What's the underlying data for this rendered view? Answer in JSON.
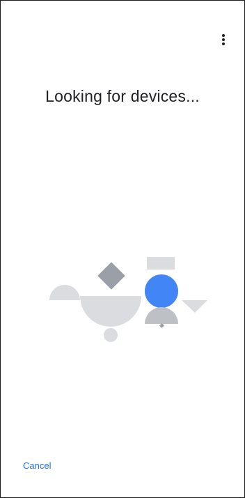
{
  "screen": {
    "title": "Looking for devices...",
    "cancel_label": "Cancel",
    "menu_icon": "more-vert-icon"
  },
  "colors": {
    "accent": "#1a73e8",
    "illustration_blue": "#4285f4",
    "illustration_gray_dark": "#9aa0a6",
    "illustration_gray_mid": "#bdc1c6",
    "illustration_gray_light": "#dadce0"
  }
}
